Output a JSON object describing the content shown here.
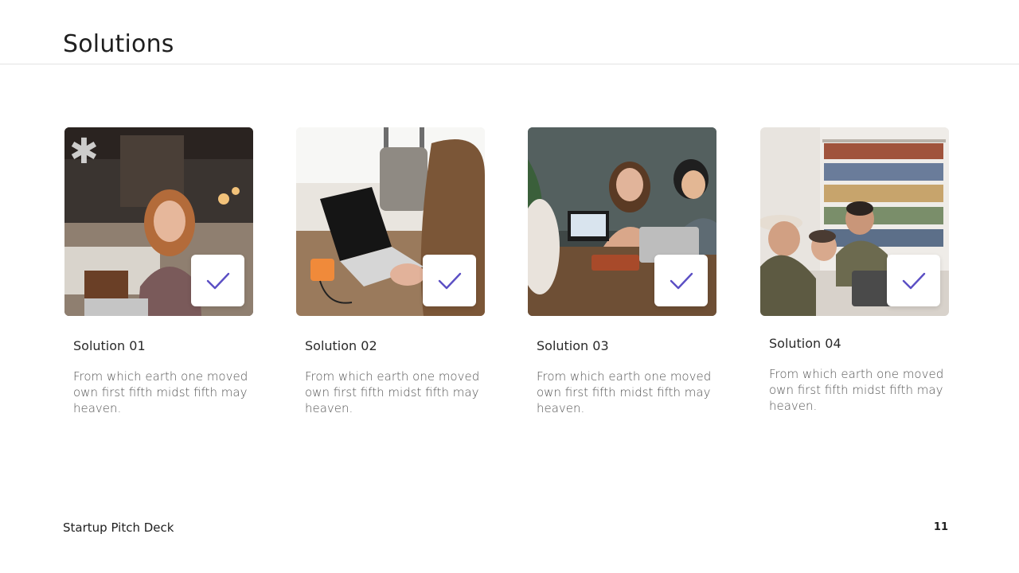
{
  "slide": {
    "title": "Solutions",
    "footer_left": "Startup Pitch Deck",
    "page_number": "11"
  },
  "accent_color": "#5B4FC4",
  "cards": [
    {
      "title": "Solution 01",
      "description": "From which earth one moved own first fifth midst fifth may heaven.",
      "icon": "check-icon"
    },
    {
      "title": "Solution 02",
      "description": "From which earth one moved own first fifth midst fifth may heaven.",
      "icon": "check-icon"
    },
    {
      "title": "Solution 03",
      "description": "From which earth one moved own first fifth midst fifth may heaven.",
      "icon": "check-icon"
    },
    {
      "title": "Solution 04",
      "description": "From which earth one moved own first fifth midst fifth may heaven.",
      "icon": "check-icon"
    }
  ]
}
